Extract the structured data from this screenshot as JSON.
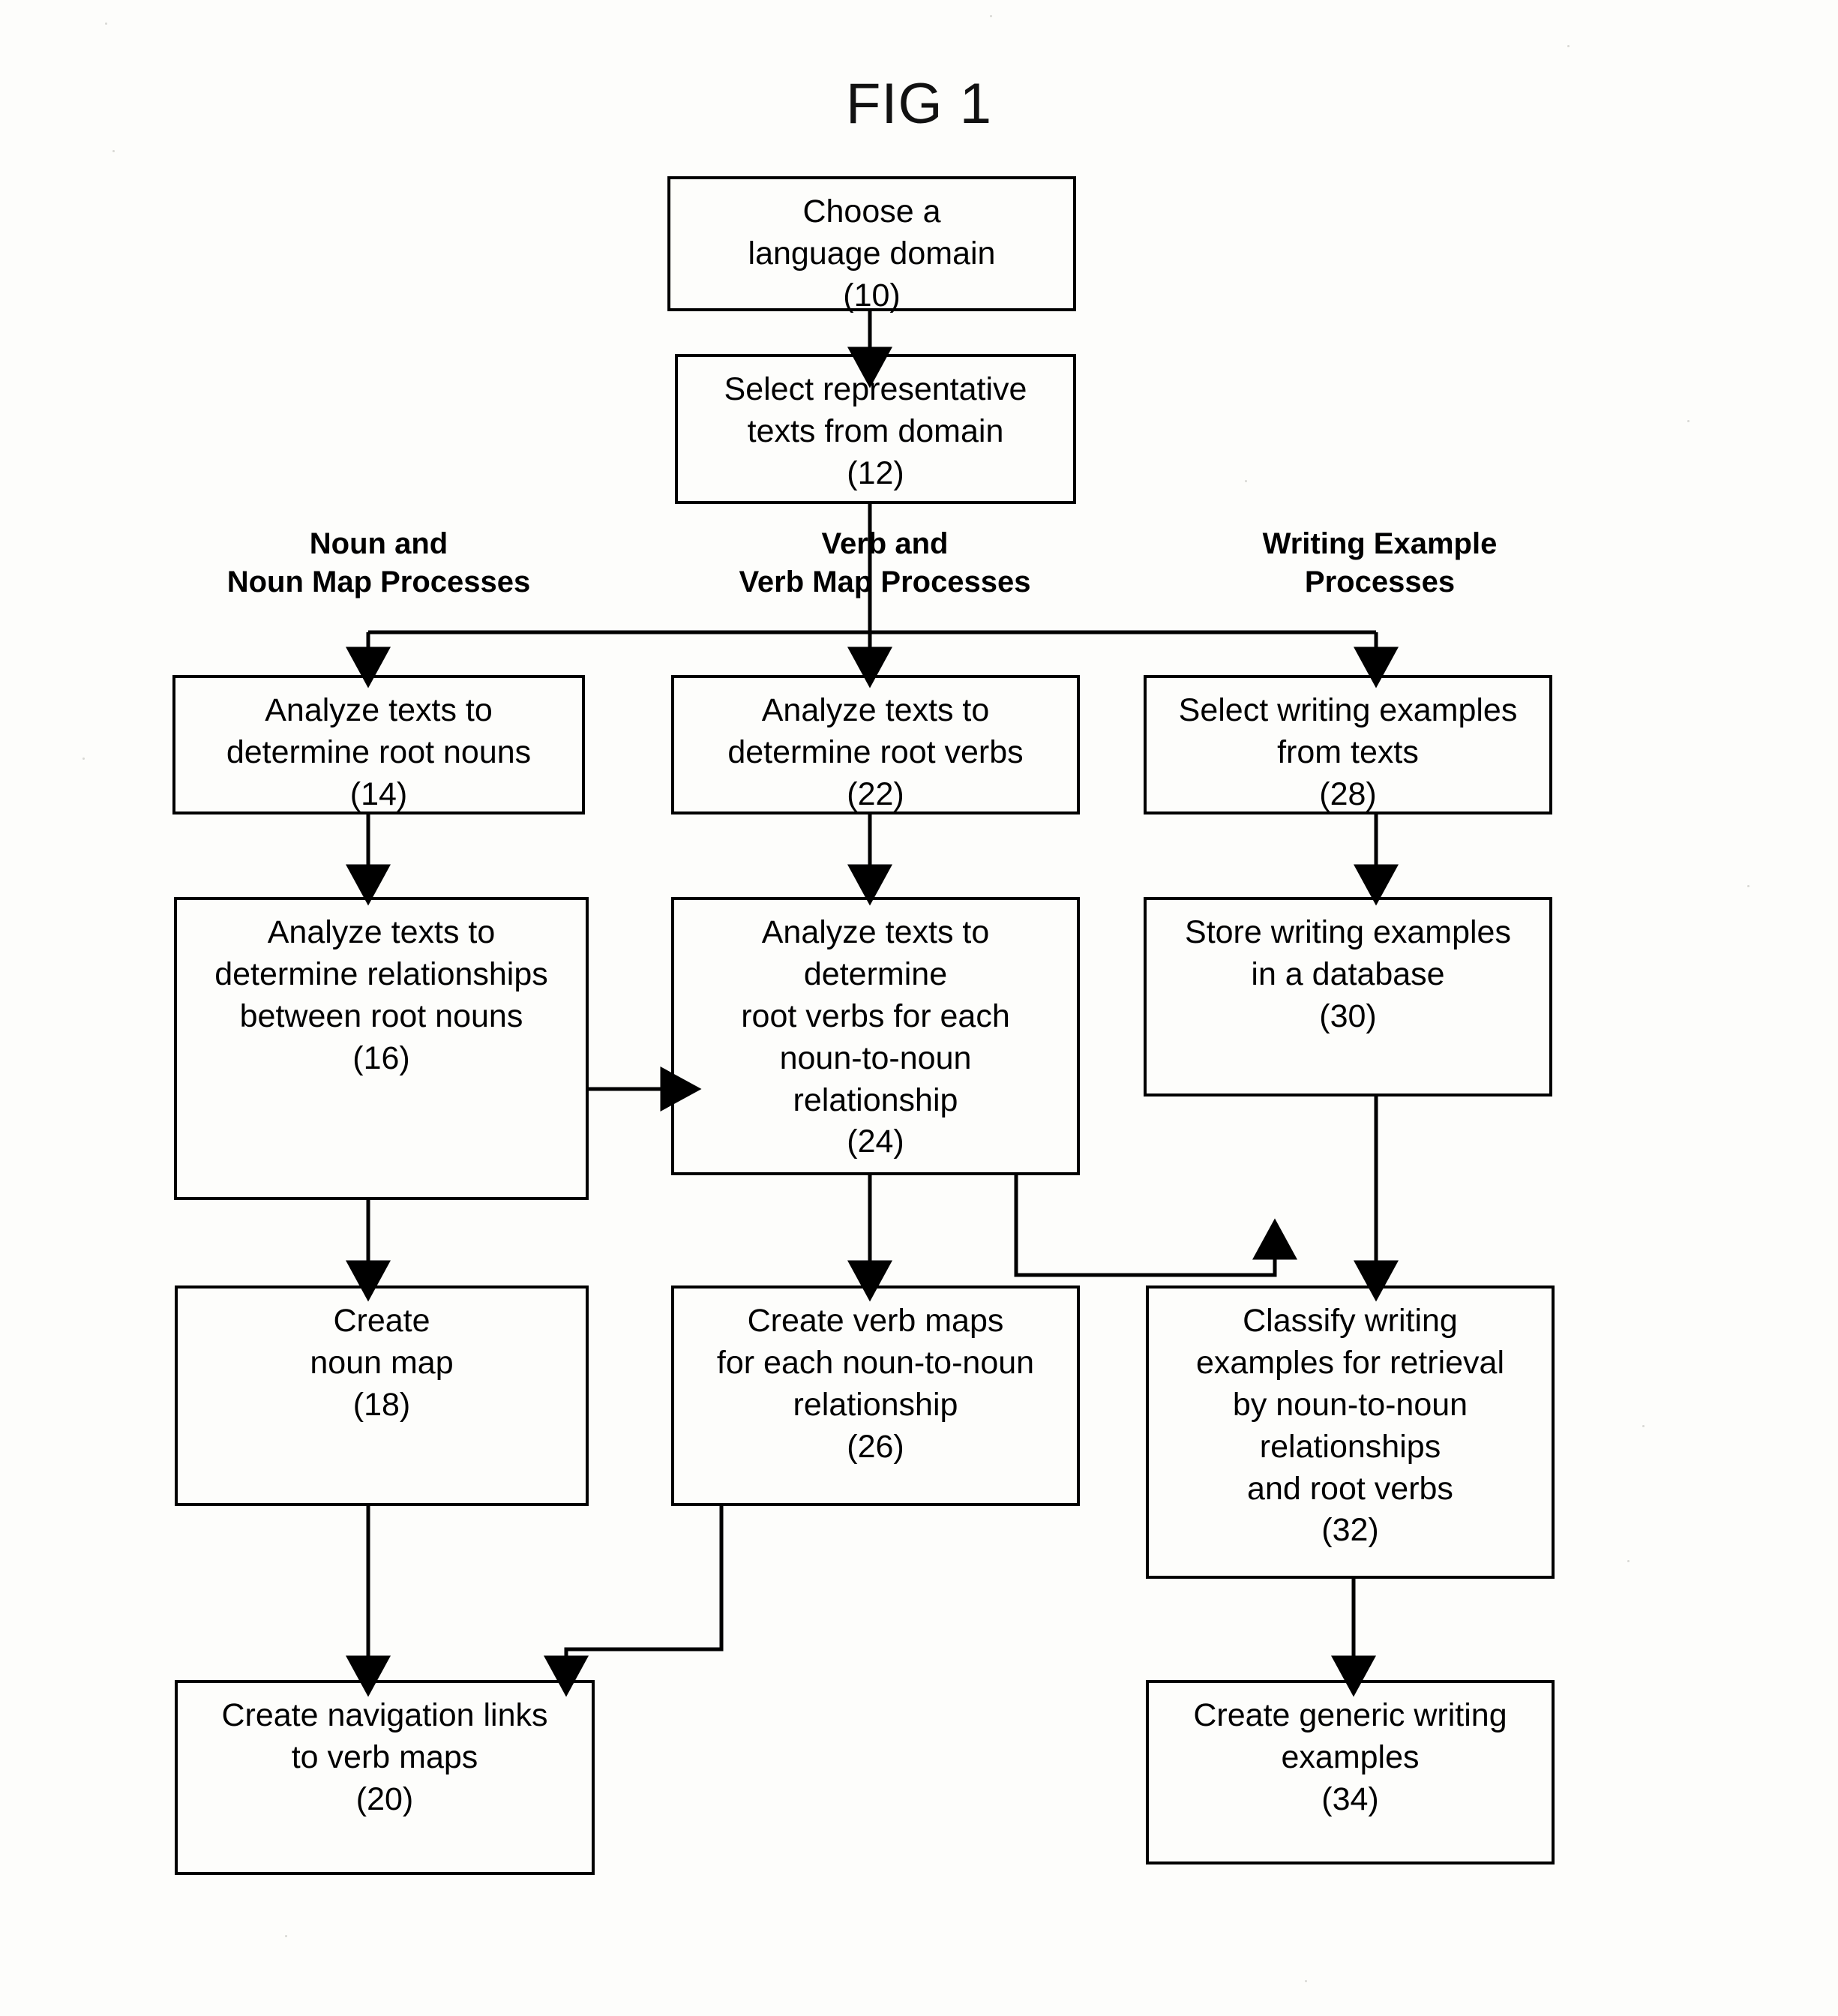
{
  "figure": {
    "title": "FIG 1",
    "type": "flowchart",
    "orientation": "top-to-bottom",
    "ink_color": "#000000",
    "background_color": "#ffffff"
  },
  "column_headers": [
    {
      "id": "noun-col",
      "label": "Noun and\nNoun Map Processes"
    },
    {
      "id": "verb-col",
      "label": "Verb and\nVerb Map Processes"
    },
    {
      "id": "writing-col",
      "label": "Writing Example\nProcesses"
    }
  ],
  "nodes": [
    {
      "id": "n10",
      "ref": "(10)",
      "column": "start",
      "label": "Choose a\nlanguage domain\n(10)"
    },
    {
      "id": "n12",
      "ref": "(12)",
      "column": "start",
      "label": "Select representative\ntexts from domain\n(12)"
    },
    {
      "id": "n14",
      "ref": "(14)",
      "column": "noun",
      "label": "Analyze texts to\ndetermine root nouns\n(14)"
    },
    {
      "id": "n16",
      "ref": "(16)",
      "column": "noun",
      "label": "Analyze texts to\ndetermine relationships\nbetween root nouns\n(16)"
    },
    {
      "id": "n18",
      "ref": "(18)",
      "column": "noun",
      "label": "Create\nnoun map\n(18)"
    },
    {
      "id": "n20",
      "ref": "(20)",
      "column": "noun",
      "label": "Create navigation links\nto verb maps\n(20)"
    },
    {
      "id": "n22",
      "ref": "(22)",
      "column": "verb",
      "label": "Analyze texts to\ndetermine root verbs\n(22)"
    },
    {
      "id": "n24",
      "ref": "(24)",
      "column": "verb",
      "label": "Analyze texts to\ndetermine\nroot verbs for each\nnoun-to-noun\nrelationship\n(24)"
    },
    {
      "id": "n26",
      "ref": "(26)",
      "column": "verb",
      "label": "Create verb maps\nfor each noun-to-noun\nrelationship\n(26)"
    },
    {
      "id": "n28",
      "ref": "(28)",
      "column": "writing",
      "label": "Select writing examples\nfrom texts\n(28)"
    },
    {
      "id": "n30",
      "ref": "(30)",
      "column": "writing",
      "label": "Store writing examples\nin a database\n(30)"
    },
    {
      "id": "n32",
      "ref": "(32)",
      "column": "writing",
      "label": "Classify writing\nexamples for retrieval\nby noun-to-noun\nrelationships\nand root verbs\n(32)"
    },
    {
      "id": "n34",
      "ref": "(34)",
      "column": "writing",
      "label": "Create generic writing\nexamples\n(34)"
    }
  ],
  "edges": [
    {
      "from": "n10",
      "to": "n12",
      "style": "straight-down"
    },
    {
      "from": "n12",
      "to": "n14",
      "style": "bus-split-left"
    },
    {
      "from": "n12",
      "to": "n22",
      "style": "straight-down"
    },
    {
      "from": "n12",
      "to": "n28",
      "style": "bus-split-right"
    },
    {
      "from": "n14",
      "to": "n16",
      "style": "straight-down"
    },
    {
      "from": "n16",
      "to": "n18",
      "style": "straight-down"
    },
    {
      "from": "n16",
      "to": "n24",
      "style": "horizontal-right"
    },
    {
      "from": "n18",
      "to": "n20",
      "style": "straight-down"
    },
    {
      "from": "n22",
      "to": "n24",
      "style": "straight-down"
    },
    {
      "from": "n24",
      "to": "n26",
      "style": "straight-down"
    },
    {
      "from": "n24",
      "to": "n32",
      "style": "elbow-down-right"
    },
    {
      "from": "n26",
      "to": "n20",
      "style": "elbow-down-left"
    },
    {
      "from": "n28",
      "to": "n30",
      "style": "straight-down"
    },
    {
      "from": "n30",
      "to": "n32",
      "style": "straight-down"
    },
    {
      "from": "n32",
      "to": "n34",
      "style": "straight-down"
    }
  ]
}
